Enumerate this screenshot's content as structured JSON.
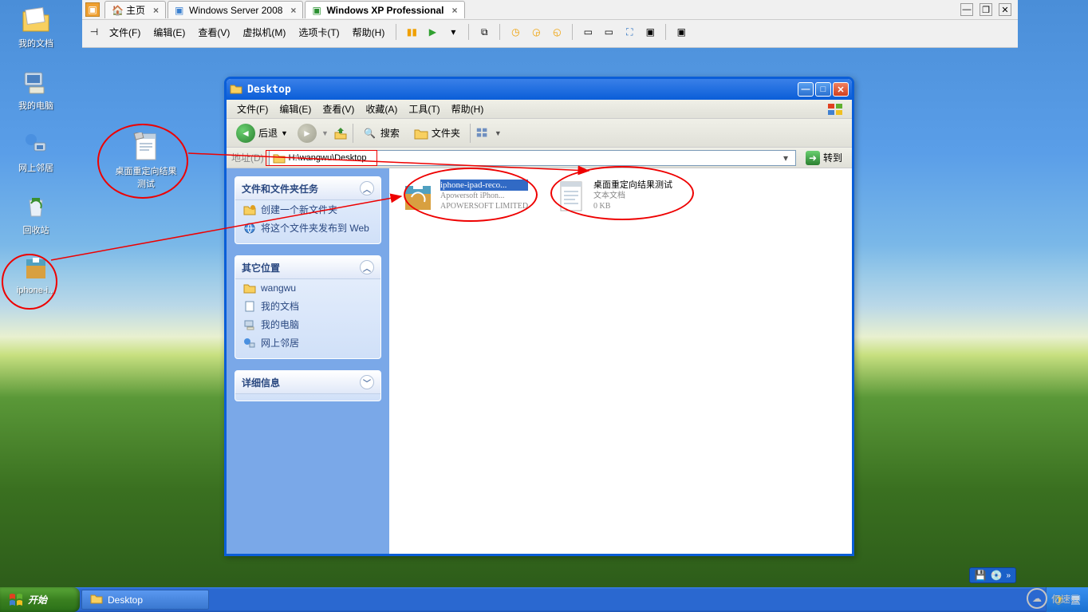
{
  "vm": {
    "tabs": [
      {
        "label": "主页",
        "icon": "home"
      },
      {
        "label": "Windows Server 2008",
        "icon": "vm"
      },
      {
        "label": "Windows XP Professional",
        "icon": "vm-active"
      }
    ],
    "menu": {
      "file": "文件(F)",
      "edit": "编辑(E)",
      "view": "查看(V)",
      "vm": "虚拟机(M)",
      "tabs": "选项卡(T)",
      "help": "帮助(H)"
    }
  },
  "desktop": {
    "mydocs": "我的文档",
    "mycomputer": "我的电脑",
    "network": "网上邻居",
    "recycle": "回收站",
    "textfile": "桌面重定向结果测试",
    "iphone": "iphone-i..."
  },
  "explorer": {
    "title": "Desktop",
    "menu": {
      "file": "文件(F)",
      "edit": "编辑(E)",
      "view": "查看(V)",
      "favorites": "收藏(A)",
      "tools": "工具(T)",
      "help": "帮助(H)"
    },
    "toolbar": {
      "back": "后退",
      "search": "搜索",
      "folders": "文件夹"
    },
    "address_label": "地址(D)",
    "address_path": "H:\\wangwu\\Desktop",
    "go": "转到",
    "sidebar": {
      "tasks_header": "文件和文件夹任务",
      "task1": "创建一个新文件夹",
      "task2": "将这个文件夹发布到 Web",
      "other_header": "其它位置",
      "loc1": "wangwu",
      "loc2": "我的文档",
      "loc3": "我的电脑",
      "loc4": "网上邻居",
      "details_header": "详细信息"
    },
    "files": [
      {
        "name": "iphone-ipad-reco...",
        "sub1": "Apowersoft iPhon...",
        "sub2": "APOWERSOFT LIMITED"
      },
      {
        "name": "桌面重定向结果测试",
        "sub1": "文本文档",
        "sub2": "0 KB"
      }
    ]
  },
  "taskbar": {
    "start": "开始",
    "task1": "Desktop"
  },
  "watermark": "亿速云"
}
